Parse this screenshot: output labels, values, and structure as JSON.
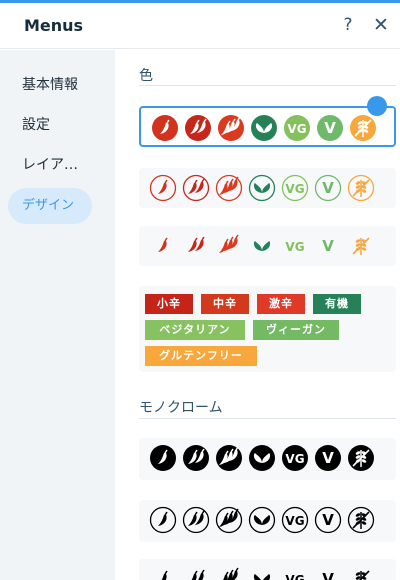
{
  "header": {
    "title": "Menus",
    "help_glyph": "?",
    "close_glyph": "✕"
  },
  "sidebar": {
    "items": [
      {
        "label": "基本情報"
      },
      {
        "label": "設定"
      },
      {
        "label": "レイア…"
      },
      {
        "label": "デザイン",
        "active": true
      }
    ]
  },
  "sections": {
    "color_title": "色",
    "mono_title": "モノクローム"
  },
  "icon_set": [
    "chili-mild-icon",
    "chili-medium-icon",
    "chili-hot-icon",
    "organic-leaf-icon",
    "vegan-icon",
    "vegetarian-icon",
    "gluten-free-icon"
  ],
  "icon_text": {
    "vegan": "VG",
    "vegetarian": "V"
  },
  "colors": {
    "mild": "#d0331e",
    "medium": "#c5271a",
    "hot": "#d93a20",
    "organic": "#268158",
    "vegan": "#84c05c",
    "vegetarian": "#6eb96a",
    "gluten_free": "#f7a73b",
    "accent": "#3899ec"
  },
  "tags": [
    {
      "label": "小辛",
      "color": "#c52418"
    },
    {
      "label": "中辛",
      "color": "#d3391c"
    },
    {
      "label": "激辛",
      "color": "#df3a27"
    },
    {
      "label": "有機",
      "color": "#268158"
    },
    {
      "label": "ベジタリアン",
      "color": "#87c160"
    },
    {
      "label": "ヴィーガン",
      "color": "#74ba62"
    },
    {
      "label": "グルテンフリー",
      "color": "#f7a73b"
    }
  ]
}
